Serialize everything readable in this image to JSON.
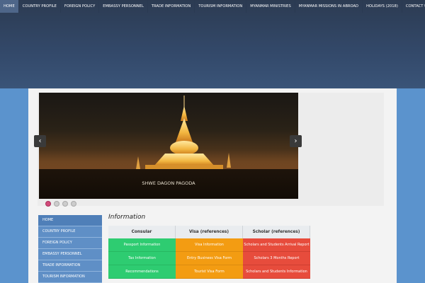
{
  "nav": [
    "HOME",
    "COUNTRY PROFILE",
    "FOREIGN POLICY",
    "EMBASSY PERSONNEL",
    "TRADE INFORMATION",
    "TOURISM INFORMATION",
    "MYANMAR MINISTRIES",
    "MYANMAR MISSIONS IN ABROAD",
    "HOLIDAYS (2018)",
    "CONTACT US"
  ],
  "slider": {
    "caption": "SHWE DAGON PAGODA",
    "prev_icon": "‹",
    "next_icon": "›"
  },
  "sidebar": [
    "HOME",
    "COUNTRY PROFILE",
    "FOREIGN POLICY",
    "EMBASSY PERSONNEL",
    "TRADE INFORMATION",
    "TOURISM INFORMATION"
  ],
  "info": {
    "title": "Information",
    "headers": [
      "Consular",
      "Visa (references)",
      "Scholar (references)"
    ],
    "rows": [
      [
        "Passport Information",
        "Visa Information",
        "Scholars and Students Arrival Report"
      ],
      [
        "Tax Information",
        "Entry Business Visa Form",
        "Scholars 3 Months Report"
      ],
      [
        "Recommendations",
        "Tourist Visa Form",
        "Scholars and Students Information"
      ]
    ]
  },
  "colors": {
    "header": "#2c3b52",
    "page_bg": "#5b93cd",
    "consular": "#2ecc71",
    "visa": "#f39c12",
    "scholar": "#e74c3c",
    "active_dot": "#d24a7a"
  }
}
